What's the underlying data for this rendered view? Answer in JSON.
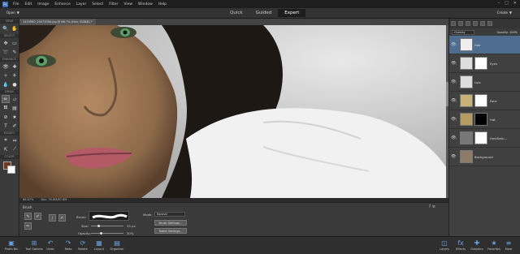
{
  "menubar": {
    "logo": "Ps",
    "items": [
      "File",
      "Edit",
      "Image",
      "Enhance",
      "Layer",
      "Select",
      "Filter",
      "View",
      "Window",
      "Help"
    ],
    "window_controls": [
      "–",
      "□",
      "✕"
    ]
  },
  "modebar": {
    "open_label": "Open",
    "tabs": [
      {
        "label": "Quick",
        "active": false
      },
      {
        "label": "Guided",
        "active": false
      },
      {
        "label": "Expert",
        "active": true
      }
    ],
    "create_label": "Create"
  },
  "toolbox": {
    "sections": [
      "VIEW",
      "SELECT",
      "ENHANCE",
      "DRAW",
      "MODIFY",
      "COLOR"
    ],
    "colors": {
      "foreground": "#6b3a1a",
      "background": "#ffffff"
    }
  },
  "document": {
    "tab_title": "1419590_20071094.jpg @ 66.7% (Hair, RGB/8) *",
    "zoom": "66.67%",
    "doc_size": "Doc: 35.8M/87.6M"
  },
  "layers_panel": {
    "blend_mode": "Overlay",
    "opacity_label": "Opacity:",
    "opacity_value": "100%",
    "layers": [
      {
        "name": "Hair",
        "selected": true
      },
      {
        "name": "Eyes",
        "selected": false
      },
      {
        "name": "Lips",
        "selected": false
      },
      {
        "name": "Face",
        "selected": false
      },
      {
        "name": "Hat",
        "selected": false
      },
      {
        "name": "Hue/Satu...",
        "selected": false
      },
      {
        "name": "Background",
        "selected": false
      }
    ]
  },
  "tool_options": {
    "tool_name": "Brush",
    "brush_label": "Brush:",
    "size_label": "Size:",
    "size_value": "25 px",
    "opacity_label": "Opacity:",
    "opacity_value": "30%",
    "opacity_fraction": 0.3,
    "mode_label": "Mode:",
    "mode_value": "Normal",
    "brush_settings": "Brush Settings...",
    "tablet_settings": "Tablet Settings..."
  },
  "bottombar": {
    "left": [
      {
        "label": "Photo Bin",
        "icon": "photo-bin-icon"
      },
      {
        "label": "Tool Options",
        "icon": "tool-options-icon"
      },
      {
        "label": "Undo",
        "icon": "undo-icon"
      },
      {
        "label": "Redo",
        "icon": "redo-icon"
      },
      {
        "label": "Rotate",
        "icon": "rotate-icon"
      },
      {
        "label": "Layout",
        "icon": "layout-icon"
      },
      {
        "label": "Organizer",
        "icon": "organizer-icon"
      }
    ],
    "right": [
      {
        "label": "Layers",
        "icon": "layers-icon"
      },
      {
        "label": "Effects",
        "icon": "effects-icon"
      },
      {
        "label": "Graphics",
        "icon": "graphics-icon"
      },
      {
        "label": "Favorites",
        "icon": "favorites-icon"
      },
      {
        "label": "More",
        "icon": "more-icon"
      }
    ]
  }
}
